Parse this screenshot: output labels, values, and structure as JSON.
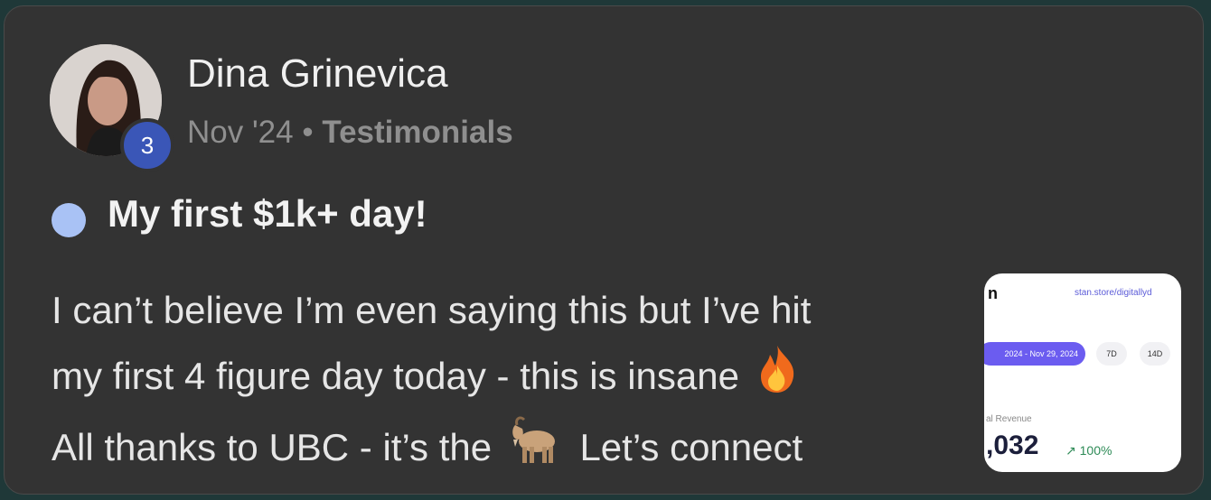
{
  "post": {
    "author": "Dina Grinevica",
    "level": "3",
    "date": "Nov '24",
    "separator": "•",
    "category": "Testimonials",
    "title": "My first $1k+ day!",
    "body_line1": "I can’t believe I’m even saying this but I’ve hit",
    "body_line2": "my first 4 figure day today - this is insane",
    "body_line3a": "All thanks to UBC - it’s the",
    "body_line3b": "Let’s connect",
    "emoji_fire": "fire-emoji",
    "emoji_goat": "goat-emoji"
  },
  "thumbnail": {
    "heading_fragment": "n",
    "url": "stan.store/digitallyd",
    "date_range": "2024 - Nov 29, 2024",
    "range_options": [
      "7D",
      "14D"
    ],
    "metric_label": "al Revenue",
    "metric_value": ",032",
    "metric_change": "↗ 100%"
  },
  "colors": {
    "card_bg": "#333333",
    "badge": "#3a56b7",
    "unread_dot": "#a9c2f5",
    "accent_purple": "#6b5cf0"
  }
}
